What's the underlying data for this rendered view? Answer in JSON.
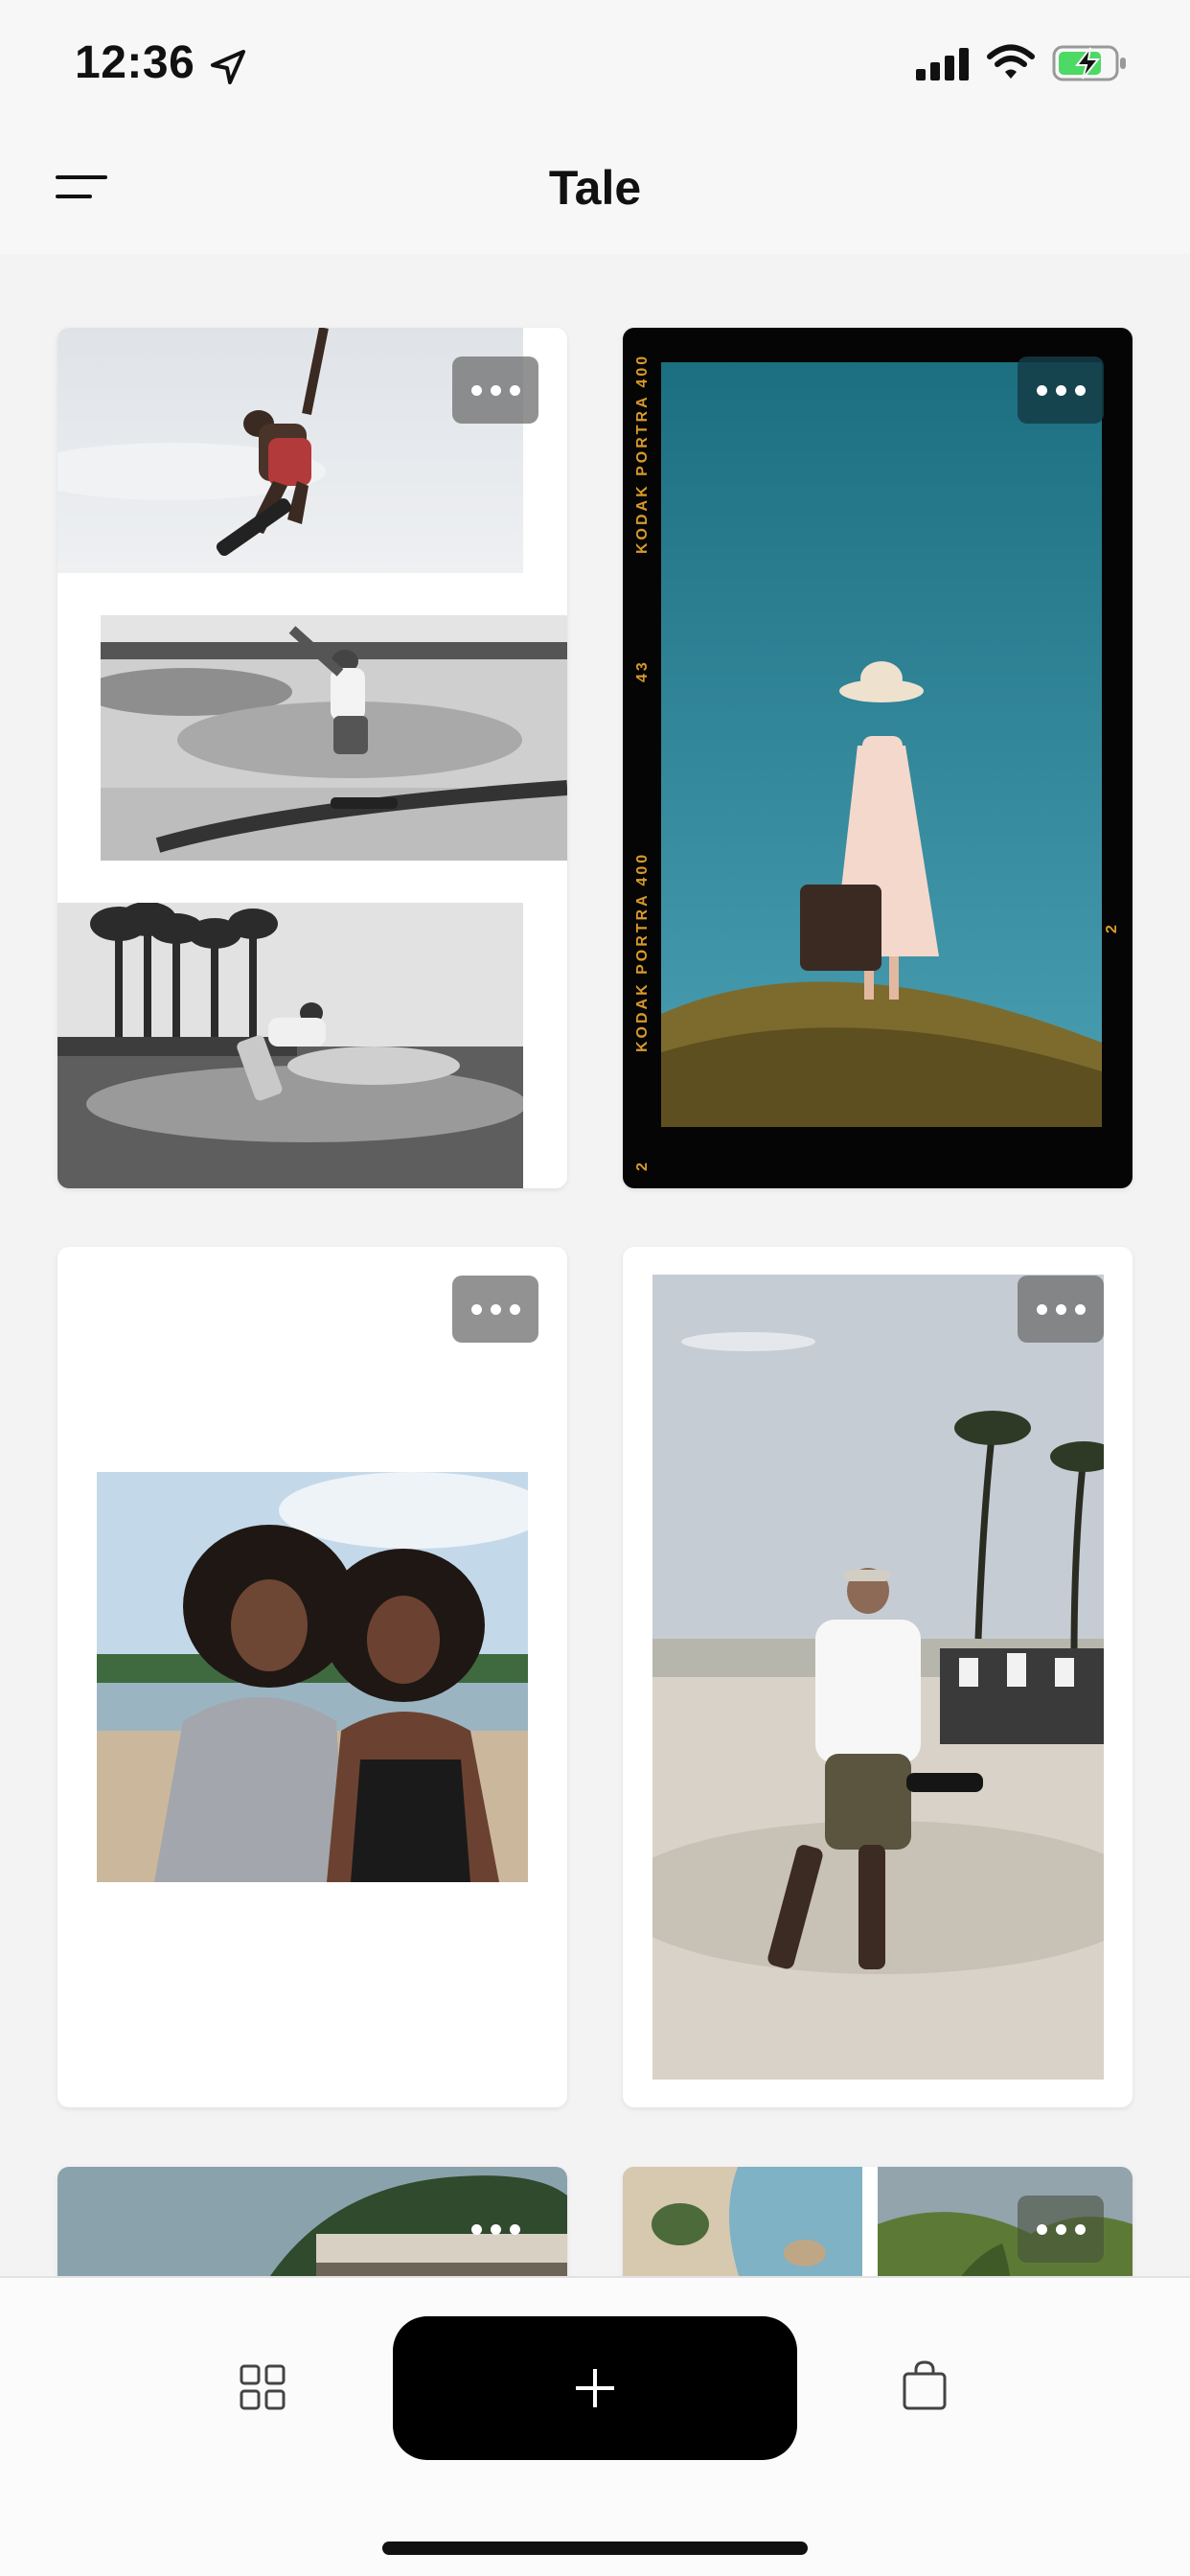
{
  "status_bar": {
    "time": "12:36",
    "icons": [
      "location-arrow-icon",
      "cellular-signal-icon",
      "wifi-icon",
      "battery-charging-icon"
    ],
    "battery_color": "#4cd964"
  },
  "header": {
    "title": "Tale",
    "menu_icon": "menu-icon"
  },
  "stories": [
    {
      "name": "skate-collage",
      "more_icon": "more-dots-icon"
    },
    {
      "name": "portrait-film",
      "more_icon": "more-dots-icon",
      "film_labels": [
        "KODAK PORTRA 400",
        "43",
        "KODAK PORTRA 400",
        "2",
        "2"
      ]
    },
    {
      "name": "friends-beach",
      "more_icon": "more-dots-icon"
    },
    {
      "name": "skatepark-walk",
      "more_icon": "more-dots-icon"
    },
    {
      "name": "coast-building",
      "more_icon": "more-dots-icon"
    },
    {
      "name": "aerial-landscape",
      "more_icon": "more-dots-icon"
    }
  ],
  "tab_bar": {
    "left_icon": "grid-icon",
    "center_button": "+",
    "right_icon": "shopping-bag-icon"
  },
  "colors": {
    "background": "#f3f3f3",
    "accent": "#000000",
    "film_text": "#d79a2a"
  }
}
